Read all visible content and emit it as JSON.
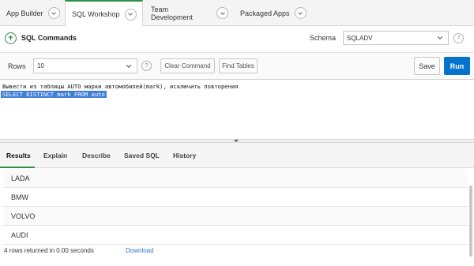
{
  "top_tabs": [
    {
      "label": "App Builder"
    },
    {
      "label": "SQL Workshop"
    },
    {
      "label": "Team Development"
    },
    {
      "label": "Packaged Apps"
    }
  ],
  "header": {
    "title": "SQL Commands",
    "schema_label": "Schema",
    "schema_value": "SQLADV",
    "help_glyph": "?"
  },
  "toolbar": {
    "rows_label": "Rows",
    "rows_value": "10",
    "help_glyph": "?",
    "clear_label": "Clear Command",
    "find_label": "Find Tables",
    "save_label": "Save",
    "run_label": "Run"
  },
  "editor": {
    "line1": "Вывести из таблицы AUTO марки автомобилей(mark), исключить повторения",
    "line2": "SELECT DISTINCT mark FROM auto"
  },
  "result_tabs": [
    {
      "label": "Results"
    },
    {
      "label": "Explain"
    },
    {
      "label": "Describe"
    },
    {
      "label": "Saved SQL"
    },
    {
      "label": "History"
    }
  ],
  "results": {
    "rows": [
      "LADA",
      "BMW",
      "VOLVO",
      "AUDI"
    ],
    "summary": "4 rows returned in 0.00 seconds",
    "download_label": "Download"
  },
  "colors": {
    "accent_green": "#2b8f4a",
    "run_blue": "#0572ce",
    "selection_blue": "#3f7fd6"
  }
}
